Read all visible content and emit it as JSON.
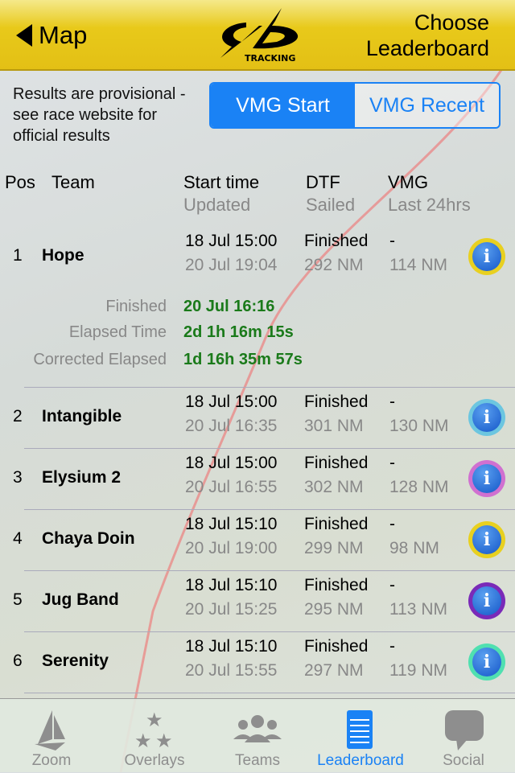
{
  "header": {
    "back_label": "Map",
    "logo_text": "TRACKING",
    "choose_label_1": "Choose",
    "choose_label_2": "Leaderboard"
  },
  "notice": "Results are provisional - see race website for official results",
  "segment": {
    "options": [
      "VMG Start",
      "VMG Recent"
    ],
    "selected": "VMG Start"
  },
  "columns": {
    "pos": "Pos",
    "team": "Team",
    "start": "Start time",
    "updated": "Updated",
    "dtf": "DTF",
    "sailed": "Sailed",
    "vmg": "VMG",
    "last24": "Last 24hrs"
  },
  "rows": [
    {
      "pos": "1",
      "team": "Hope",
      "start": "18 Jul 15:00",
      "updated": "20 Jul 19:04",
      "dtf": "Finished",
      "sailed": "292 NM",
      "vmg": "-",
      "last24": "114 NM",
      "ring": "#e8d020"
    },
    {
      "pos": "2",
      "team": "Intangible",
      "start": "18 Jul 15:00",
      "updated": "20 Jul 16:35",
      "dtf": "Finished",
      "sailed": "301 NM",
      "vmg": "-",
      "last24": "130 NM",
      "ring": "#6cc6e0"
    },
    {
      "pos": "3",
      "team": "Elysium 2",
      "start": "18 Jul 15:00",
      "updated": "20 Jul 16:55",
      "dtf": "Finished",
      "sailed": "302 NM",
      "vmg": "-",
      "last24": "128 NM",
      "ring": "#d070d0"
    },
    {
      "pos": "4",
      "team": "Chaya Doin",
      "start": "18 Jul 15:10",
      "updated": "20 Jul 19:00",
      "dtf": "Finished",
      "sailed": "299 NM",
      "vmg": "-",
      "last24": "98 NM",
      "ring": "#e8d020"
    },
    {
      "pos": "5",
      "team": "Jug Band",
      "start": "18 Jul 15:10",
      "updated": "20 Jul 15:25",
      "dtf": "Finished",
      "sailed": "295 NM",
      "vmg": "-",
      "last24": "113 NM",
      "ring": "#7a2ab8"
    },
    {
      "pos": "6",
      "team": "Serenity",
      "start": "18 Jul 15:10",
      "updated": "20 Jul 15:55",
      "dtf": "Finished",
      "sailed": "297 NM",
      "vmg": "-",
      "last24": "119 NM",
      "ring": "#50e0b0"
    }
  ],
  "details": {
    "finished_label": "Finished",
    "finished": "20 Jul 16:16",
    "elapsed_label": "Elapsed Time",
    "elapsed": "2d 1h 16m 15s",
    "corrected_label": "Corrected Elapsed",
    "corrected": "1d 16h 35m 57s"
  },
  "tabs": [
    {
      "label": "Zoom",
      "icon": "sailboat-icon"
    },
    {
      "label": "Overlays",
      "icon": "stars-icon"
    },
    {
      "label": "Teams",
      "icon": "people-icon"
    },
    {
      "label": "Leaderboard",
      "icon": "notepad-icon",
      "active": true
    },
    {
      "label": "Social",
      "icon": "speech-bubble-icon"
    }
  ],
  "colors": {
    "accent": "#1a82f5",
    "header": "#e3c015",
    "corrected_text": "#1a7a1a"
  }
}
